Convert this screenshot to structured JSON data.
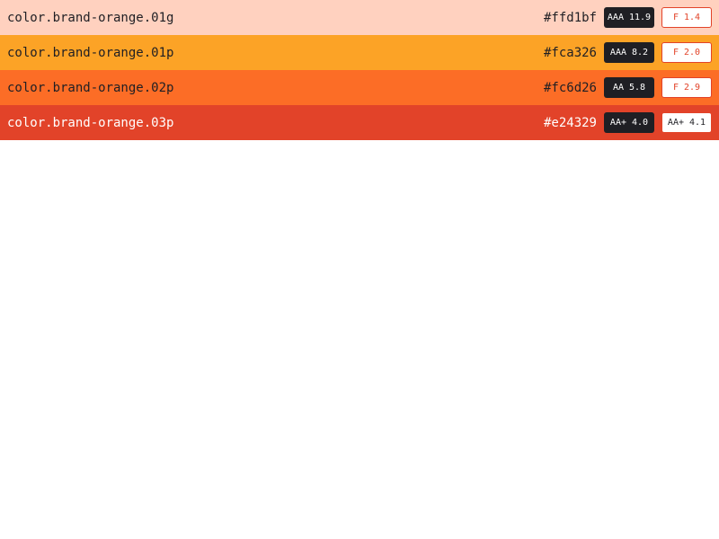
{
  "swatches": [
    {
      "name": "color.brand-orange.01g",
      "hex": "#ffd1bf",
      "bg": "#ffd1bf",
      "text_color": "#1f1f24",
      "dark_contrast": "AAA 11.9",
      "light_contrast": "F 1.4",
      "light_text_color": "#e24329"
    },
    {
      "name": "color.brand-orange.01p",
      "hex": "#fca326",
      "bg": "#fca326",
      "text_color": "#1f1f24",
      "dark_contrast": "AAA 8.2",
      "light_contrast": "F 2.0",
      "light_text_color": "#e24329"
    },
    {
      "name": "color.brand-orange.02p",
      "hex": "#fc6d26",
      "bg": "#fc6d26",
      "text_color": "#1f1f24",
      "dark_contrast": "AA 5.8",
      "light_contrast": "F 2.9",
      "light_text_color": "#e24329"
    },
    {
      "name": "color.brand-orange.03p",
      "hex": "#e24329",
      "bg": "#e24329",
      "text_color": "#ffffff",
      "dark_contrast": "AA+ 4.0",
      "light_contrast": "AA+ 4.1",
      "light_text_color": "#1f1f24"
    }
  ]
}
